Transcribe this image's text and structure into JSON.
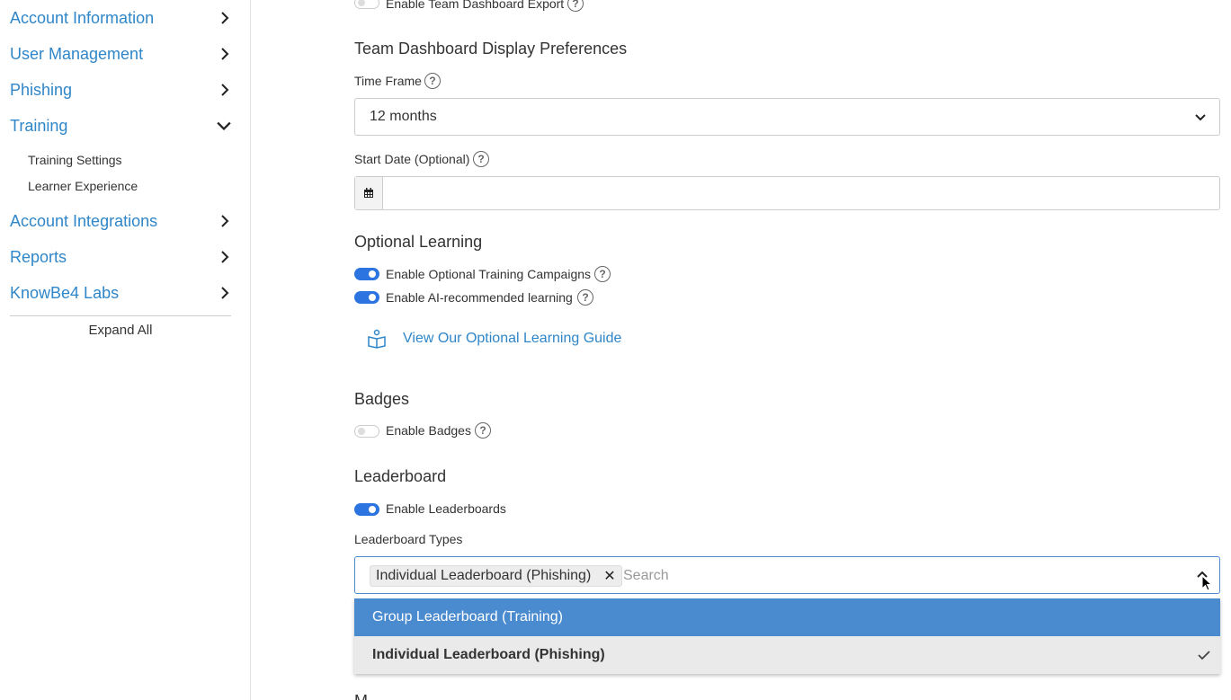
{
  "sidebar": {
    "items": [
      {
        "label": "Account Information",
        "expanded": false
      },
      {
        "label": "User Management",
        "expanded": false
      },
      {
        "label": "Phishing",
        "expanded": false
      },
      {
        "label": "Training",
        "expanded": true
      },
      {
        "label": "Account Integrations",
        "expanded": false
      },
      {
        "label": "Reports",
        "expanded": false
      },
      {
        "label": "KnowBe4 Labs",
        "expanded": false
      }
    ],
    "training_sub": [
      "Training Settings",
      "Learner Experience"
    ],
    "expand_all": "Expand All"
  },
  "main": {
    "top_toggle": {
      "label": "Enable Team Dashboard Export",
      "on": false
    },
    "display_prefs_title": "Team Dashboard Display Preferences",
    "time_frame": {
      "label": "Time Frame",
      "value": "12 months"
    },
    "start_date": {
      "label": "Start Date (Optional)",
      "value": ""
    },
    "optional_learning": {
      "title": "Optional Learning",
      "toggles": [
        {
          "label": "Enable Optional Training Campaigns",
          "on": true
        },
        {
          "label": "Enable AI-recommended learning",
          "on": true
        }
      ],
      "guide_link": "View Our Optional Learning Guide"
    },
    "badges": {
      "title": "Badges",
      "toggle": {
        "label": "Enable Badges",
        "on": false
      }
    },
    "leaderboard": {
      "title": "Leaderboard",
      "toggle": {
        "label": "Enable Leaderboards",
        "on": true
      },
      "types_label": "Leaderboard Types",
      "selected_tag": "Individual Leaderboard (Phishing)",
      "search_placeholder": "Search",
      "options": [
        {
          "label": "Group Leaderboard (Training)",
          "highlighted": true,
          "selected": false
        },
        {
          "label": "Individual Leaderboard (Phishing)",
          "highlighted": false,
          "selected": true
        }
      ]
    },
    "next_section_partial": "M"
  },
  "colors": {
    "link": "#2f86c8",
    "toggle_on": "#2c74e0",
    "option_highlight": "#4a8bd0"
  }
}
